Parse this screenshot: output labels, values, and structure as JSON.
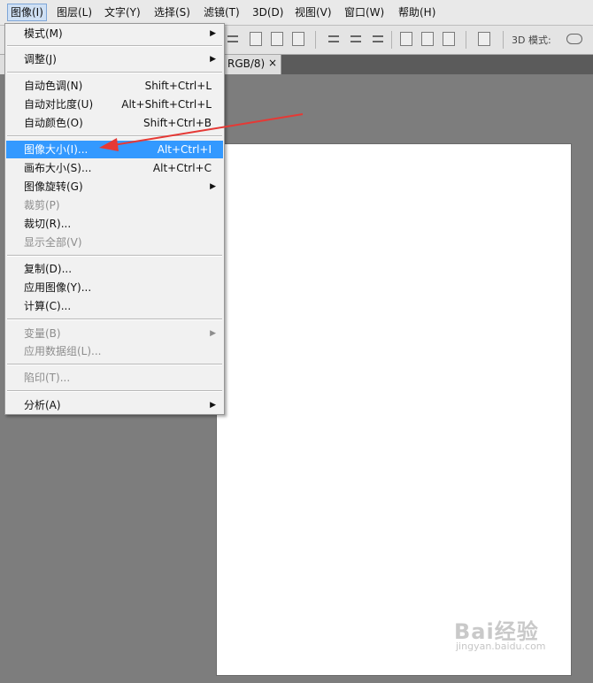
{
  "menubar": {
    "items": [
      {
        "label": "图像(I)"
      },
      {
        "label": "图层(L)"
      },
      {
        "label": "文字(Y)"
      },
      {
        "label": "选择(S)"
      },
      {
        "label": "滤镜(T)"
      },
      {
        "label": "3D(D)"
      },
      {
        "label": "视图(V)"
      },
      {
        "label": "窗口(W)"
      },
      {
        "label": "帮助(H)"
      }
    ]
  },
  "options_bar": {
    "mode_label": "3D 模式:"
  },
  "document_tab": {
    "title": "RGB/8)",
    "close": "×"
  },
  "image_menu": {
    "items": [
      {
        "label": "模式(M)",
        "shortcut": "",
        "submenu": true,
        "disabled": false
      },
      {
        "label": "调整(J)",
        "shortcut": "",
        "submenu": true,
        "disabled": false
      },
      {
        "label": "自动色调(N)",
        "shortcut": "Shift+Ctrl+L",
        "submenu": false,
        "disabled": false
      },
      {
        "label": "自动对比度(U)",
        "shortcut": "Alt+Shift+Ctrl+L",
        "submenu": false,
        "disabled": false
      },
      {
        "label": "自动颜色(O)",
        "shortcut": "Shift+Ctrl+B",
        "submenu": false,
        "disabled": false
      },
      {
        "label": "图像大小(I)...",
        "shortcut": "Alt+Ctrl+I",
        "submenu": false,
        "disabled": false,
        "highlighted": true
      },
      {
        "label": "画布大小(S)...",
        "shortcut": "Alt+Ctrl+C",
        "submenu": false,
        "disabled": false
      },
      {
        "label": "图像旋转(G)",
        "shortcut": "",
        "submenu": true,
        "disabled": false
      },
      {
        "label": "裁剪(P)",
        "shortcut": "",
        "submenu": false,
        "disabled": true
      },
      {
        "label": "裁切(R)...",
        "shortcut": "",
        "submenu": false,
        "disabled": false
      },
      {
        "label": "显示全部(V)",
        "shortcut": "",
        "submenu": false,
        "disabled": true
      },
      {
        "label": "复制(D)...",
        "shortcut": "",
        "submenu": false,
        "disabled": false
      },
      {
        "label": "应用图像(Y)...",
        "shortcut": "",
        "submenu": false,
        "disabled": false
      },
      {
        "label": "计算(C)...",
        "shortcut": "",
        "submenu": false,
        "disabled": false
      },
      {
        "label": "变量(B)",
        "shortcut": "",
        "submenu": true,
        "disabled": true
      },
      {
        "label": "应用数据组(L)...",
        "shortcut": "",
        "submenu": false,
        "disabled": true
      },
      {
        "label": "陷印(T)...",
        "shortcut": "",
        "submenu": false,
        "disabled": true
      },
      {
        "label": "分析(A)",
        "shortcut": "",
        "submenu": true,
        "disabled": false
      }
    ],
    "submenu_arrow": "▶"
  },
  "watermark": {
    "brand": "Bai经验",
    "site": "jingyan.baidu.com"
  },
  "colors": {
    "highlight": "#3399ff",
    "annotation_arrow": "#e53935",
    "workspace": "#7d7d7d"
  }
}
